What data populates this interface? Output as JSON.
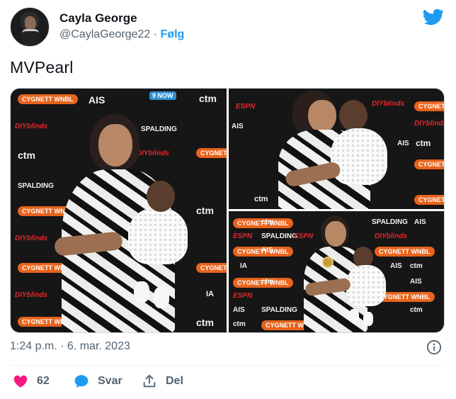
{
  "author": {
    "display_name": "Cayla George",
    "handle": "@CaylaGeorge22",
    "separator": "·",
    "follow_label": "Følg"
  },
  "tweet": {
    "text": "MVPearl"
  },
  "media_logos": {
    "cygnett": "CYGNETT WNBL",
    "ais": "AIS",
    "nine_now": "9 NOW",
    "ctm": "ctm",
    "diy": "DIYblinds",
    "spalding": "SPALDING",
    "espn": "ESPN",
    "athletic": "IA"
  },
  "footer": {
    "timestamp": "1:24 p.m. · 6. mar. 2023",
    "likes": "62",
    "reply_label": "Svar",
    "share_label": "Del"
  },
  "colors": {
    "brand_blue": "#1d9bf0",
    "like_pink": "#f91880",
    "muted": "#536471",
    "sponsor_orange": "#e8631c"
  },
  "icons": [
    "avatar",
    "twitter-bird-icon",
    "info-icon",
    "heart-icon",
    "reply-bubble-icon",
    "share-icon"
  ]
}
